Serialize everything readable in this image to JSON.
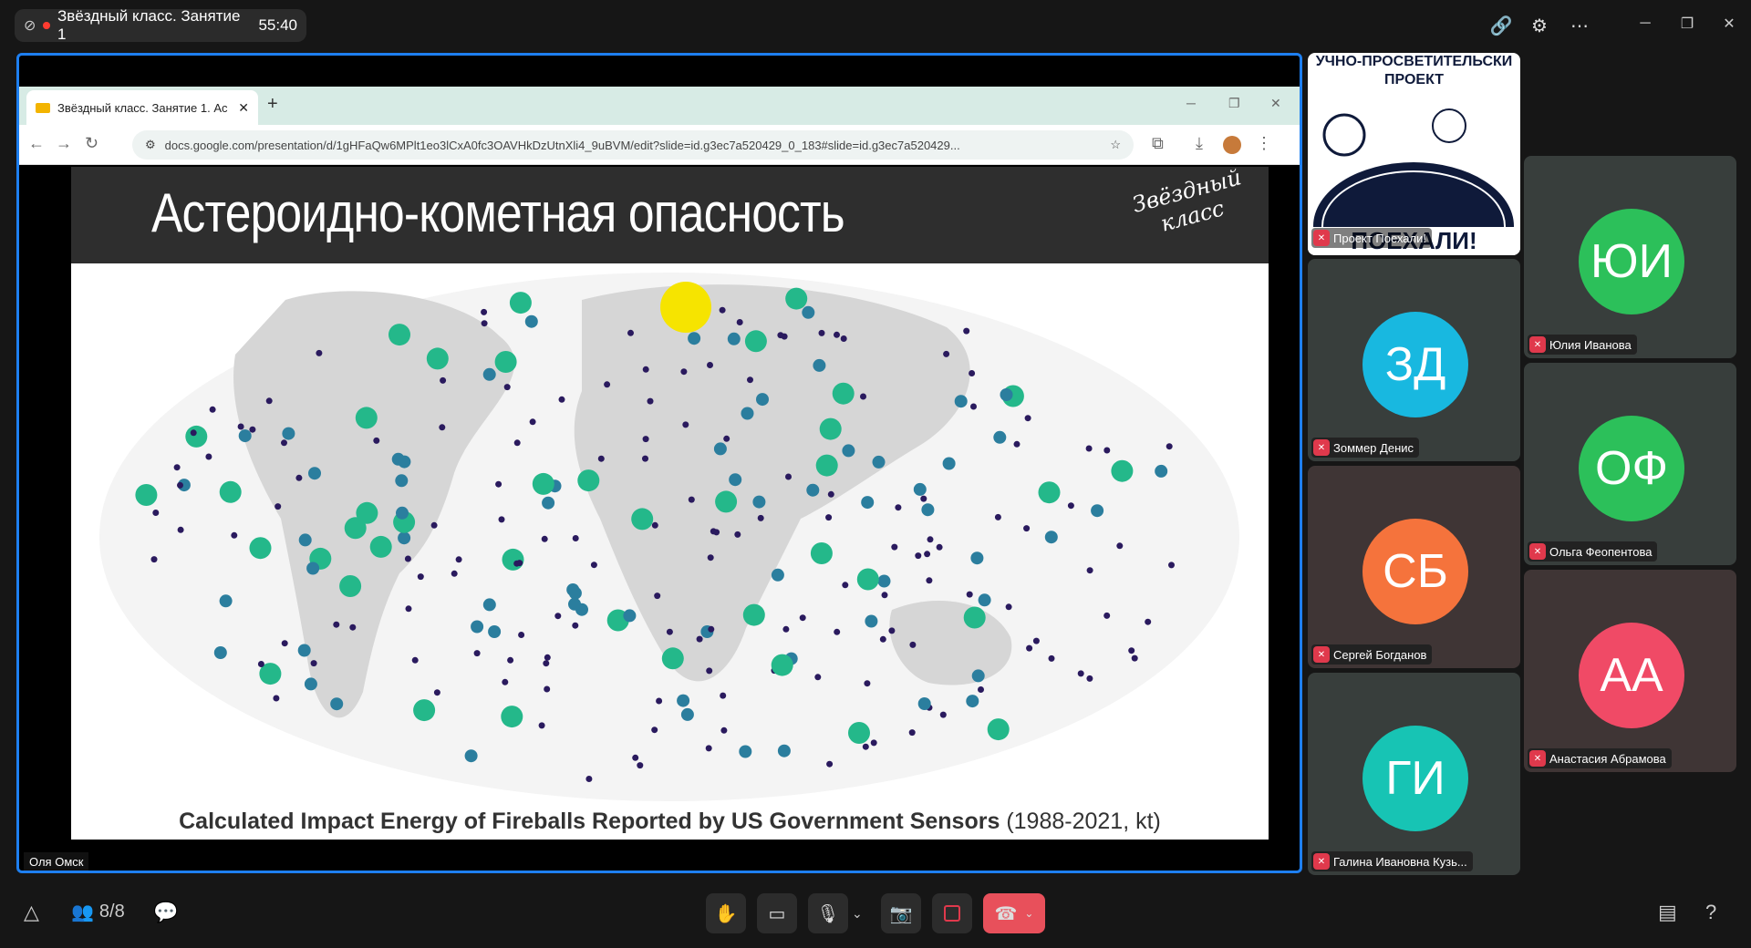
{
  "meeting": {
    "title": "Звёздный класс. Занятие 1",
    "timer": "55:40"
  },
  "participants_count": "8/8",
  "browser": {
    "tab_title": "Звёздный класс. Занятие 1. Ас",
    "url": "docs.google.com/presentation/d/1gHFaQw6MPlt1eo3lCxA0fc3OAVHkDzUtnXli4_9uBVM/edit?slide=id.g3ec7a520429_0_183#slide=id.g3ec7a520429..."
  },
  "slide": {
    "title": "Астероидно-кометная опасность",
    "logo_text": "Звёздный класс",
    "caption_bold": "Calculated Impact Energy of Fireballs Reported by US Government Sensors",
    "caption_rest": "(1988-2021, kt)"
  },
  "presenter_name": "Оля Омск",
  "project_tile": {
    "banner_top": "УЧНО-ПРОСВЕТИТЕЛЬСКИ",
    "banner_mid": "ПРОЕКТ",
    "banner_bottom": "ПОЕХАЛИ!",
    "label": "Проект Поехали!"
  },
  "tiles": [
    {
      "initials": "ЗД",
      "name": "Зоммер Денис",
      "color": "#18b8e0"
    },
    {
      "initials": "СБ",
      "name": "Сергей Богданов",
      "color": "#f5733c"
    },
    {
      "initials": "ГИ",
      "name": "Галина Ивановна Кузь...",
      "color": "#17c4b4"
    },
    {
      "initials": "ЮИ",
      "name": "Юлия Иванова",
      "color": "#2cc05a"
    },
    {
      "initials": "ОФ",
      "name": "Ольга Феопентова",
      "color": "#2cc05a"
    },
    {
      "initials": "АА",
      "name": "Анастасия Абрамова",
      "color": "#f04a66"
    }
  ]
}
